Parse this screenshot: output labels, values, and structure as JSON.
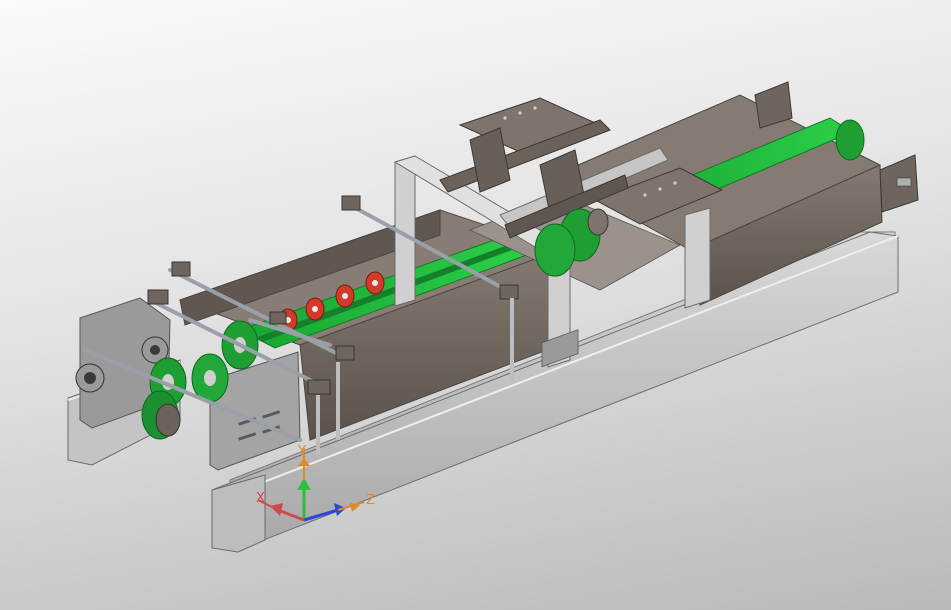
{
  "view": {
    "background_top": "#fafafa",
    "background_bottom": "#b9b9b9"
  },
  "model": {
    "frame_color": "#c8c8c8",
    "frame_dark": "#8a8a8a",
    "body_color": "#6f665e",
    "plate_color": "#7a716a",
    "belt_color": "#20b838",
    "roller_color": "#1f9e33",
    "wheel_color": "#d23a2a",
    "rod_color": "#9aa0a8"
  },
  "triad": {
    "x_label": "X",
    "y_label": "Y",
    "z_label": "Z",
    "x_color": "#d04a4a",
    "y_color": "#2fbf3a",
    "z_color": "#2d48d8",
    "label_color": "#e08a2a"
  }
}
